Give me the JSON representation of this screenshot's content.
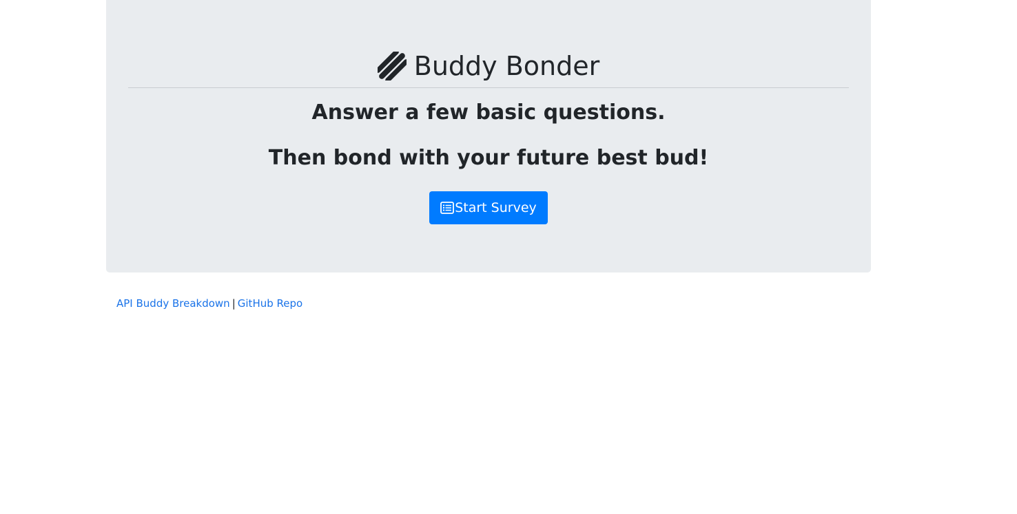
{
  "header": {
    "title": "Buddy Bonder",
    "logo_icon": "hotdog-icon"
  },
  "hero": {
    "line1": "Answer a few basic questions.",
    "line2": "Then bond with your future best bud!",
    "button_label": "Start Survey",
    "button_icon": "list-alt-icon"
  },
  "footer": {
    "link1": "API Buddy Breakdown",
    "separator": "|",
    "link2": "GitHub Repo"
  },
  "colors": {
    "jumbotron_bg": "#e9ecef",
    "primary": "#007bff",
    "link": "#1a73e8",
    "text": "#212529"
  }
}
